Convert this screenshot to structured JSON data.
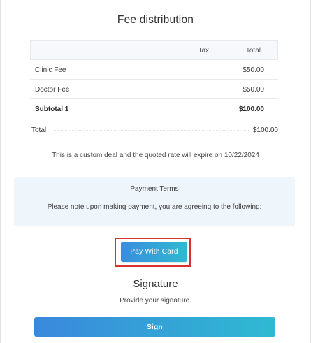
{
  "fee_section": {
    "title": "Fee distribution",
    "columns": {
      "tax": "Tax",
      "total": "Total"
    },
    "rows": [
      {
        "label": "Clinic Fee",
        "total": "$50.00"
      },
      {
        "label": "Doctor Fee",
        "total": "$50.00"
      },
      {
        "label": "Subtotal 1",
        "total": "$100.00"
      }
    ],
    "grand_total": {
      "label": "Total",
      "value": "$100.00"
    },
    "note": "This is a custom deal and the quoted rate will expire on 10/22/2024"
  },
  "payment_terms": {
    "title": "Payment Terms",
    "text": "Please note upon making payment, you are agreeing to the following:"
  },
  "pay_button": {
    "label": "Pay With Card"
  },
  "signature": {
    "title": "Signature",
    "subtitle": "Provide your signature.",
    "button_label": "Sign"
  },
  "colors": {
    "highlight_border": "#d8302d",
    "button_gradient_start": "#3a8cde",
    "button_gradient_end": "#2fbad1",
    "terms_background": "#eef5fb"
  }
}
